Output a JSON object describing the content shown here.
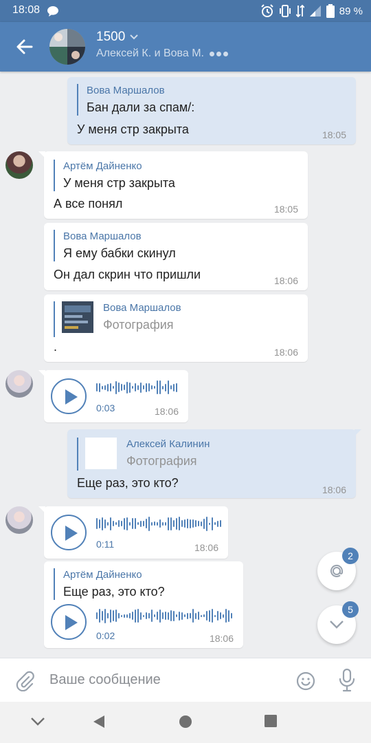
{
  "status_bar": {
    "time": "18:08",
    "battery": "89 %"
  },
  "header": {
    "title": "1500",
    "subtitle": "Алексей К. и Вова М."
  },
  "messages": {
    "m1": {
      "quote_author": "Вова Маршалов",
      "quote_text": "Бан дали за спам/:",
      "text": "У меня стр закрыта",
      "time": "18:05"
    },
    "m2": {
      "quote_author": "Артём Дайненко",
      "quote_text": "У меня стр закрыта",
      "text": "А все понял",
      "time": "18:05"
    },
    "m3": {
      "quote_author": "Вова Маршалов",
      "quote_text": "Я ему бабки скинул",
      "text": "Он дал скрин что пришли",
      "time": "18:06"
    },
    "m4": {
      "quote_author": "Вова Маршалов",
      "quote_text": "Фотография",
      "text": ".",
      "time": "18:06"
    },
    "m5": {
      "duration": "0:03",
      "time": "18:06"
    },
    "m6": {
      "quote_author": "Алексей Калинин",
      "quote_text": "Фотография",
      "text": "Еще раз, это кто?",
      "time": "18:06"
    },
    "m7": {
      "duration": "0:11",
      "time": "18:06"
    },
    "m8": {
      "quote_author": "Артём Дайненко",
      "quote_text": "Еще раз, это кто?",
      "duration": "0:02",
      "time": "18:06"
    }
  },
  "fabs": {
    "mentions_count": "2",
    "unread_count": "5"
  },
  "composer": {
    "placeholder": "Ваше сообщение"
  },
  "colors": {
    "accent": "#5181b8",
    "status_bar": "#4a76a8",
    "outgoing_bubble": "#dce6f3",
    "background": "#edeef0"
  },
  "icons": [
    "back-arrow-icon",
    "chevron-down-icon",
    "paperclip-icon",
    "emoji-icon",
    "microphone-icon",
    "at-icon",
    "play-icon",
    "nav-back-icon",
    "nav-home-icon",
    "nav-recents-icon"
  ]
}
